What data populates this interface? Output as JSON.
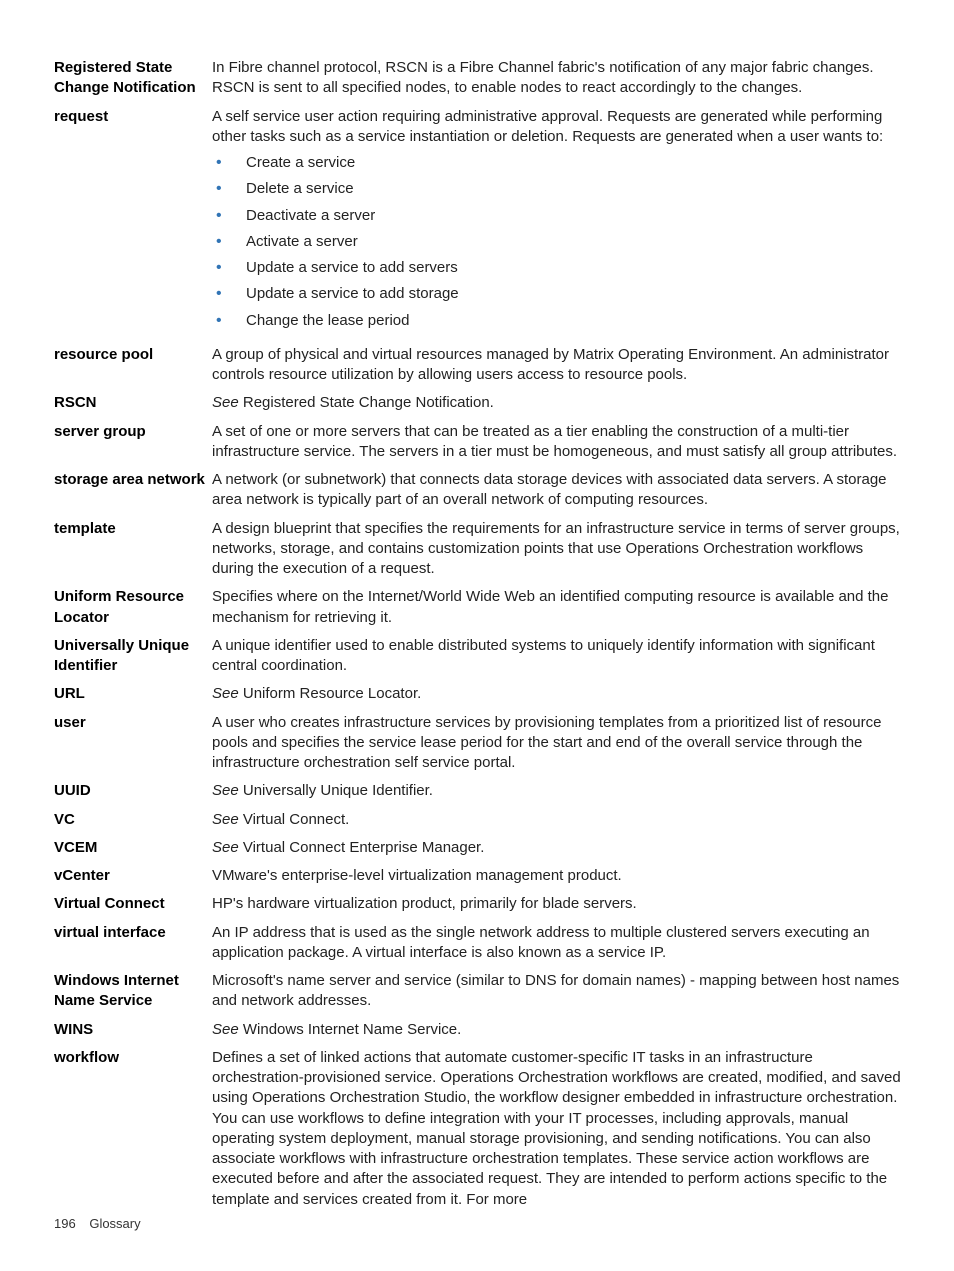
{
  "entries": [
    {
      "term": "Registered State Change Notification",
      "paragraphs": [
        "In Fibre channel protocol, RSCN is a Fibre Channel fabric's notification of any major fabric changes. RSCN is sent to all specified nodes, to enable nodes to react accordingly to the changes."
      ]
    },
    {
      "term": "request",
      "paragraphs": [
        "A self service user action requiring administrative approval. Requests are generated while performing other tasks such as a service instantiation or deletion. Requests are generated when a user wants to:"
      ],
      "bullets": [
        "Create a service",
        "Delete a service",
        "Deactivate a server",
        "Activate a server",
        "Update a service to add servers",
        "Update a service to add storage",
        "Change the lease period"
      ]
    },
    {
      "term": "resource pool",
      "paragraphs": [
        "A group of physical and virtual resources managed by Matrix Operating Environment. An administrator controls resource utilization by allowing users access to resource pools."
      ]
    },
    {
      "term": "RSCN",
      "see": "Registered State Change Notification."
    },
    {
      "term": "server group",
      "paragraphs": [
        "A set of one or more servers that can be treated as a tier enabling the construction of a multi-tier infrastructure service. The servers in a tier must be homogeneous, and must satisfy all group attributes."
      ]
    },
    {
      "term": "storage area network",
      "paragraphs": [
        "A network (or subnetwork) that connects data storage devices with associated data servers. A storage area network is typically part of an overall network of computing resources."
      ]
    },
    {
      "term": "template",
      "paragraphs": [
        "A design blueprint that specifies the requirements for an infrastructure service in terms of server groups, networks, storage, and contains customization points that use Operations Orchestration workflows during the execution of a request."
      ]
    },
    {
      "term": "Uniform Resource Locator",
      "paragraphs": [
        "Specifies where on the Internet/World Wide Web an identified computing resource is available and the mechanism for retrieving it."
      ]
    },
    {
      "term": "Universally Unique Identifier",
      "paragraphs": [
        "A unique identifier used to enable distributed systems to uniquely identify information with significant central coordination."
      ]
    },
    {
      "term": "URL",
      "see": "Uniform Resource Locator."
    },
    {
      "term": "user",
      "paragraphs": [
        "A user who creates infrastructure services by provisioning templates from a prioritized list of resource pools and specifies the service lease period for the start and end of the overall service through the infrastructure orchestration self service portal."
      ]
    },
    {
      "term": "UUID",
      "see": "Universally Unique Identifier."
    },
    {
      "term": "VC",
      "see": "Virtual Connect."
    },
    {
      "term": "VCEM",
      "see": "Virtual Connect Enterprise Manager."
    },
    {
      "term": "vCenter",
      "paragraphs": [
        "VMware's enterprise-level virtualization management product."
      ]
    },
    {
      "term": "Virtual Connect",
      "paragraphs": [
        "HP's hardware virtualization product, primarily for blade servers."
      ]
    },
    {
      "term": "virtual interface",
      "paragraphs": [
        "An IP address that is used as the single network address to multiple clustered servers executing an application package. A virtual interface is also known as a service IP."
      ]
    },
    {
      "term": "Windows Internet Name Service",
      "paragraphs": [
        "Microsoft's name server and service (similar to DNS for domain names) - mapping between host names and network addresses."
      ]
    },
    {
      "term": "WINS",
      "see": "Windows Internet Name Service."
    },
    {
      "term": "workflow",
      "paragraphs": [
        "Defines a set of linked actions that automate customer-specific IT tasks in an infrastructure orchestration-provisioned service. Operations Orchestration workflows are created, modified, and saved using Operations Orchestration Studio, the workflow designer embedded in infrastructure orchestration. You can use workflows to define integration with your IT processes, including approvals, manual operating system deployment, manual storage provisioning, and sending notifications. You can also associate workflows with infrastructure orchestration templates. These service action workflows are executed before and after the associated request. They are intended to perform actions specific to the template and services created from it. For more"
      ]
    }
  ],
  "see_label": "See",
  "footer": {
    "page_number": "196",
    "section": "Glossary"
  }
}
